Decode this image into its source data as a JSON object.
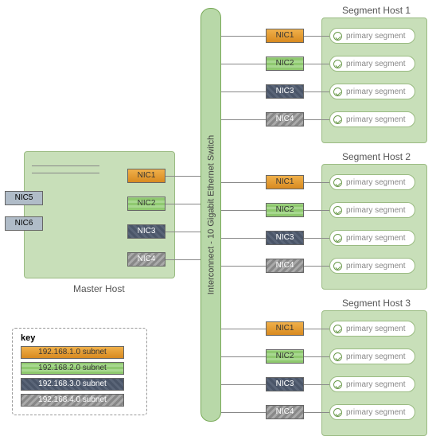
{
  "switch_label": "Interconnect - 10 Gigabit Ethernet Switch",
  "master": {
    "title": "Master Host",
    "nics": [
      "NIC1",
      "NIC2",
      "NIC3",
      "NIC4"
    ],
    "ext": [
      "NIC5",
      "NIC6"
    ]
  },
  "segments": [
    {
      "title": "Segment Host 1",
      "nics": [
        "NIC1",
        "NIC2",
        "NIC3",
        "NIC4"
      ]
    },
    {
      "title": "Segment Host 2",
      "nics": [
        "NIC1",
        "NIC2",
        "NIC3",
        "NIC4"
      ]
    },
    {
      "title": "Segment Host 3",
      "nics": [
        "NIC1",
        "NIC2",
        "NIC3",
        "NIC4"
      ]
    }
  ],
  "pill_label": "primary segment",
  "key": {
    "title": "key",
    "items": [
      "192.168.1.0 subnet",
      "192.168.2.0 subnet",
      "192.168.3.0 subnet",
      "192.168.4.0 subnet"
    ]
  }
}
